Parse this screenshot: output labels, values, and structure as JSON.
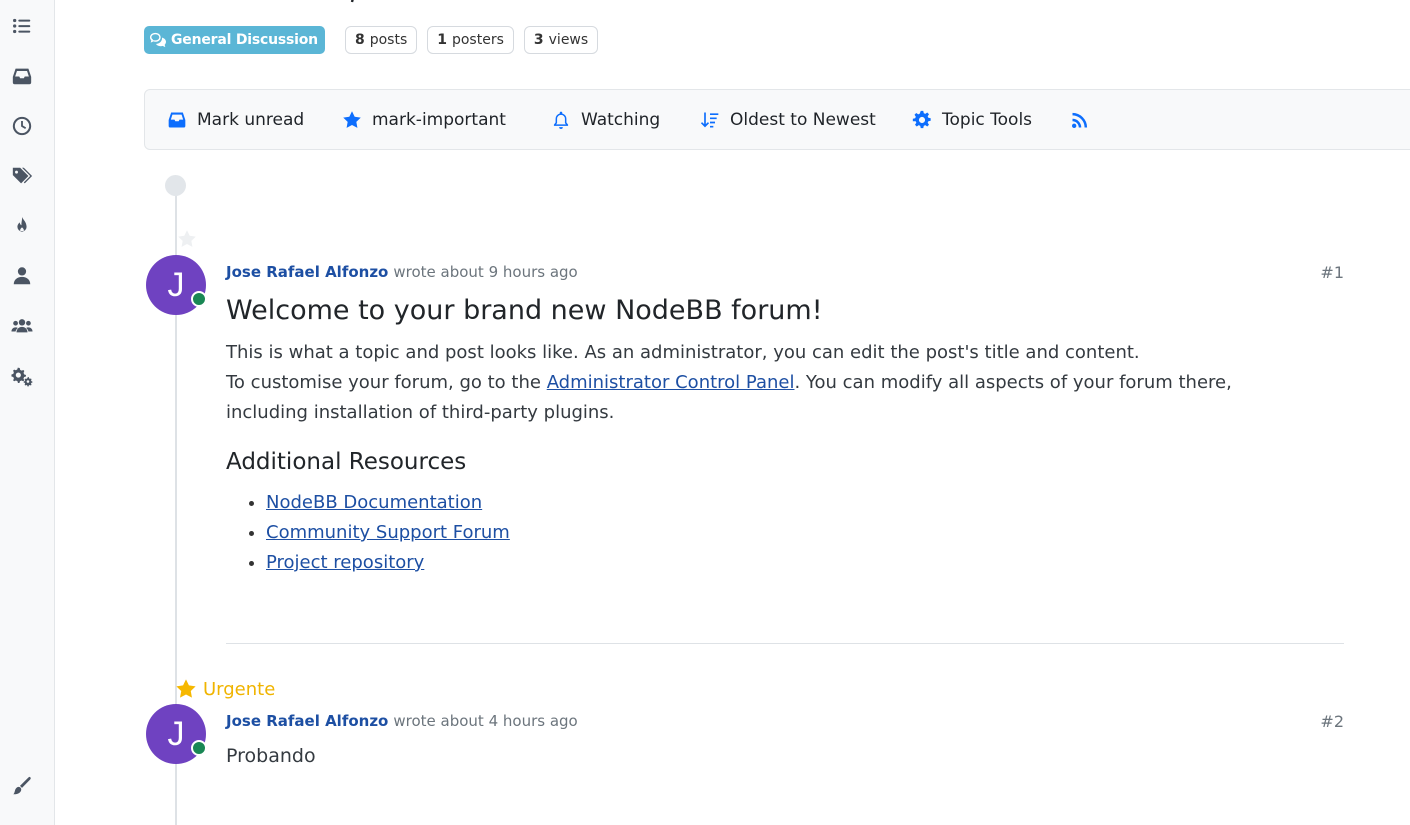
{
  "topic": {
    "category": "General Discussion",
    "stats": [
      {
        "count": "8",
        "label": "posts"
      },
      {
        "count": "1",
        "label": "posters"
      },
      {
        "count": "3",
        "label": "views"
      }
    ]
  },
  "sidebar": {
    "items": [
      {
        "icon": "list-icon"
      },
      {
        "icon": "inbox-icon"
      },
      {
        "icon": "clock-icon"
      },
      {
        "icon": "tags-icon"
      },
      {
        "icon": "fire-icon"
      },
      {
        "icon": "user-icon"
      },
      {
        "icon": "users-icon"
      },
      {
        "icon": "gears-icon"
      },
      {
        "icon": "brush-icon"
      }
    ]
  },
  "toolbar": {
    "mark_unread": "Mark unread",
    "mark_important": "mark-important",
    "watching": "Watching",
    "sort": "Oldest to Newest",
    "topic_tools": "Topic Tools"
  },
  "posts": [
    {
      "author": "Jose Rafael Alfonzo",
      "avatar_letter": "J",
      "time": "wrote about 9 hours ago",
      "index": "#1",
      "title": "Welcome to your brand new NodeBB forum!",
      "p1": "This is what a topic and post looks like. As an administrator, you can edit the post's title and content.",
      "p2_pre": "To customise your forum, go to the ",
      "p2_link": "Administrator Control Panel",
      "p2_post": ". You can modify all aspects of your forum there,",
      "p3": "including installation of third-party plugins.",
      "resources_heading": "Additional Resources",
      "resources": [
        "NodeBB Documentation",
        "Community Support Forum",
        "Project repository"
      ]
    },
    {
      "badge": "Urgente",
      "author": "Jose Rafael Alfonzo",
      "avatar_letter": "J",
      "time": "wrote about 4 hours ago",
      "index": "#2",
      "body": "Probando"
    }
  ],
  "colors": {
    "accent": "#0d6efd",
    "category": "#5bb6d6",
    "avatar": "#6f42c1",
    "online": "#198754",
    "urgent": "#f6b800",
    "link": "#1d4fa3"
  }
}
